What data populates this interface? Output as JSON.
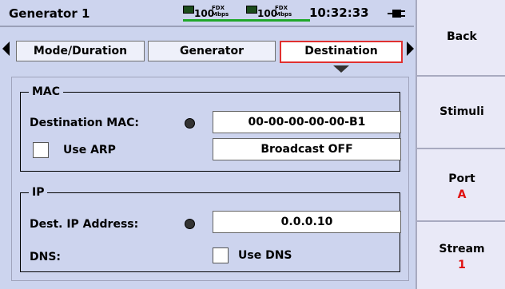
{
  "header": {
    "title": "Generator 1",
    "port1": {
      "speed": "100",
      "duplex_top": "FDX",
      "duplex_bottom": "Mbps"
    },
    "port2": {
      "speed": "100",
      "duplex_top": "FDX",
      "duplex_bottom": "Mbps"
    },
    "time": "10:32:33"
  },
  "tabs": [
    {
      "label": "Mode/Duration"
    },
    {
      "label": "Generator"
    },
    {
      "label": "Destination"
    }
  ],
  "mac": {
    "group_label": "MAC",
    "dest_label": "Destination MAC:",
    "dest_value": "00-00-00-00-00-B1",
    "arp_label": "Use ARP",
    "broadcast_value": "Broadcast OFF"
  },
  "ip": {
    "group_label": "IP",
    "addr_label": "Dest. IP Address:",
    "addr_value": "0.0.0.10",
    "dns_label": "DNS:",
    "use_dns_label": "Use DNS"
  },
  "sidebar": {
    "back": "Back",
    "stimuli": "Stimuli",
    "port_label": "Port",
    "port_value": "A",
    "stream_label": "Stream",
    "stream_value": "1"
  }
}
